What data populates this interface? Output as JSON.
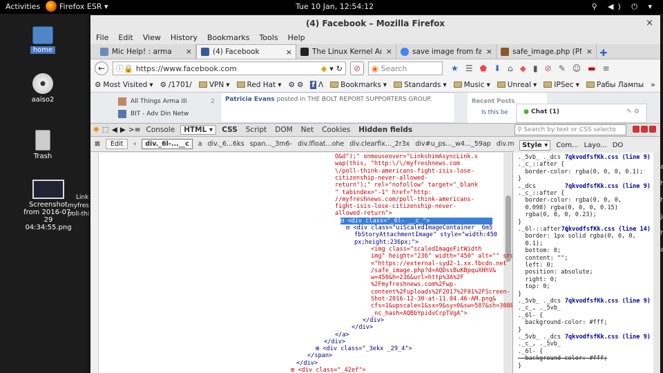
{
  "topbar": {
    "activities": "Activities",
    "app": "Firefox ESR ▾",
    "clock": "Tue 10 Jan, 12:54:12",
    "tray": "⚲ ◀) ⏻ ▾"
  },
  "desktop": {
    "icons": [
      {
        "label": "home"
      },
      {
        "label": "aaiso2"
      },
      {
        "label": "Trash"
      },
      {
        "label": "Screenshot from 2016-07-29 04:34:55.png"
      }
    ],
    "extra_text": [
      "Link",
      "myfres",
      "poll-thi"
    ]
  },
  "window": {
    "title": "(4) Facebook – Mozilla Firefox",
    "close": "×"
  },
  "menu": [
    "File",
    "Edit",
    "View",
    "History",
    "Bookmarks",
    "Tools",
    "Help"
  ],
  "tabs": [
    {
      "label": "Mic Help! : arma",
      "color": "#6a8db5"
    },
    {
      "label": "(4) Facebook",
      "color": "#3b5998"
    },
    {
      "label": "The Linux Kernel Arc...",
      "color": "#222222"
    },
    {
      "label": "save image from face...",
      "color": "#4285f4"
    },
    {
      "label": "safe_image.php (PNG...",
      "color": "#8a5a2a"
    }
  ],
  "nav": {
    "url": "https://www.facebook.com",
    "search_placeholder": "Search"
  },
  "bookmarks": [
    "Most Visited",
    "/1701/",
    "VPN",
    "Red Hat",
    "Bookmarks",
    "Standards",
    "Music",
    "Unreal",
    "IPSec",
    "Рабы Лампы"
  ],
  "fbpage": {
    "left": [
      {
        "label": "All Things Arma III",
        "count": "2"
      },
      {
        "label": "BIT - Adv Din Netw",
        "count": ""
      }
    ],
    "post": {
      "author": "Patricia Evans",
      "text": "posted in THE BOLT REPORT SUPPORTERS GROUP."
    },
    "recent": "Recent Posts",
    "recent_item": "Is this be",
    "chat": "Chat (1)"
  },
  "devtools": {
    "tools": [
      "Console",
      "HTML ▾",
      "CSS",
      "Script",
      "DOM",
      "Net",
      "Cookies",
      "Hidden fields"
    ],
    "search_placeholder": "Search by text or CSS selecto",
    "edit": "Edit",
    "crumbs": [
      "div._6l-...__c",
      "a",
      "div._6...6ks",
      "span..._3m6-",
      "div.lfloat...ohe",
      "div.clearfix..._2r3x",
      "div#u_ps..._w4..._59ap",
      "div.mtm"
    ],
    "side_tabs": [
      "Style ▾",
      "Com...",
      "Layo...",
      "DO"
    ],
    "html_lines": [
      "O&d\");\" onmouseover=\"LinkshimAsyncLink.s",
      "wap(this, \"http:\\/\\/myfreshnews.com",
      "\\/poll-think-americans-fight-isis-lose-",
      "citizenship-never-allowed-",
      "return\");\" rel=\"nofollow\" target=\"_blank",
      "\" tabindex=\"-1\" href=\"http:",
      "//myfreshnews.com/poll-think-americans-",
      "fight-isis-lose-citizenship-never-",
      "allowed-return\">",
      "⊟ <div class=\"_6l- __c_\">",
      "⊟ <div class=\"uiScaledImageContainer _6m5",
      "fbStoryAttachmentImage\" style=\"width:450",
      "px;height:236px;\">",
      "<img class=\"scaledImageFitWidth",
      "img\" height=\"236\" width=\"450\" alt=\"\" src",
      "=\"https://external-syd2-1.xx.fbcdn.net",
      "/safe_image.php?d=AQDssBuKBpquXHhV&",
      "w=450&h=236&url=http%3A%2F",
      "%2Fmyfreshnews.com%2Fwp-",
      "content%2Fuploads%2F2017%2F01%2FScreen-",
      "Shot-2016-12-30-at-11.04.46-AM.png&",
      "cfs=1&upscale=1&sx=9&sy=0&sw=587&sh=308&",
      "_nc_hash=AQBbYpidvCrpTVgA\">",
      "</div>",
      "</div>",
      "</a>",
      "</div>",
      "⊞ <div class=\"_3ekx _29_4\">",
      "</span>",
      "</div>",
      "⊞ <div class=\"_42ef\">",
      "</div>"
    ],
    "css_rules": [
      {
        "sel": "._5vb_ ._dcs",
        "src": "7qkvodfsfKk.css (line 9)"
      },
      {
        "sel": "._c_::after {",
        "src": ""
      },
      {
        "sel": "  border-color: rgba(0, 0, 0, 0.1);",
        "src": ""
      },
      {
        "sel": "}",
        "src": ""
      },
      {
        "sel": "._dcs",
        "src": "7qkvodfsfKk.css (line 9)"
      },
      {
        "sel": "._c_::after {",
        "src": ""
      },
      {
        "sel": "  border-color: rgba(0, 0, 0,",
        "src": ""
      },
      {
        "sel": "  0.098) rgba(0, 0, 0, 0.15)",
        "src": ""
      },
      {
        "sel": "  rgba(0, 0, 0, 0.23);",
        "src": ""
      },
      {
        "sel": "}",
        "src": ""
      },
      {
        "sel": "._6l-::after {",
        "src": "7qkvodfsfKk.css (line 14)"
      },
      {
        "sel": "  border: 1px solid rgba(0, 0, 0,",
        "src": ""
      },
      {
        "sel": "  0.1);",
        "src": ""
      },
      {
        "sel": "  bottom: 0;",
        "src": ""
      },
      {
        "sel": "  content: \"\";",
        "src": ""
      },
      {
        "sel": "  left: 0;",
        "src": ""
      },
      {
        "sel": "  position: absolute;",
        "src": ""
      },
      {
        "sel": "  right: 0;",
        "src": ""
      },
      {
        "sel": "  top: 0;",
        "src": ""
      },
      {
        "sel": "}",
        "src": ""
      },
      {
        "sel": "._5vb_ ._dcs",
        "src": "7qkvodfsfKk.css (line 9)"
      },
      {
        "sel": "._c_, ._5vb_",
        "src": ""
      },
      {
        "sel": "._6l- {",
        "src": ""
      },
      {
        "sel": "  background-color: #fff;",
        "src": ""
      },
      {
        "sel": "}",
        "src": ""
      },
      {
        "sel": "._5vb_ ._dcs",
        "src": "7qkvodfsfKk.css (line 9)"
      },
      {
        "sel": "._c_, ._5vb_",
        "src": ""
      },
      {
        "sel": "._6l- {",
        "src": ""
      },
      {
        "sel": "  background-color: #fff;",
        "src": ""
      },
      {
        "sel": "}",
        "src": ""
      }
    ]
  },
  "right_edge": [
    "ac",
    "ha",
    "ha",
    "ja",
    "ha",
    "a"
  ]
}
